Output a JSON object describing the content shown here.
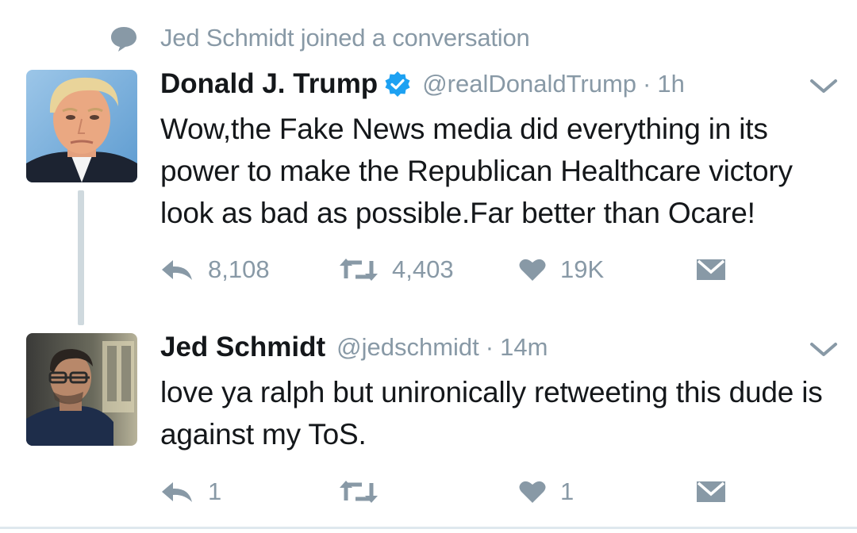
{
  "context": {
    "icon": "speech-bubble-icon",
    "text": "Jed Schmidt joined a conversation"
  },
  "tweets": [
    {
      "name": "Donald J. Trump",
      "verified": true,
      "handle": "@realDonaldTrump",
      "separator": "·",
      "time": "1h",
      "text": "Wow,the Fake News media did everything in its power to make the Republican Healthcare victory look as bad as possible.Far better than Ocare!",
      "actions": {
        "reply_count": "8,108",
        "retweet_count": "4,403",
        "like_count": "19K"
      }
    },
    {
      "name": "Jed Schmidt",
      "verified": false,
      "handle": "@jedschmidt",
      "separator": "·",
      "time": "14m",
      "text": "love ya ralph but unironically retweeting this dude is against my ToS.",
      "actions": {
        "reply_count": "1",
        "retweet_count": "",
        "like_count": "1"
      }
    }
  ],
  "colors": {
    "text": "#14171a",
    "muted": "#8899a6",
    "verified": "#1da1f2",
    "thread_line": "#cfd9de"
  }
}
